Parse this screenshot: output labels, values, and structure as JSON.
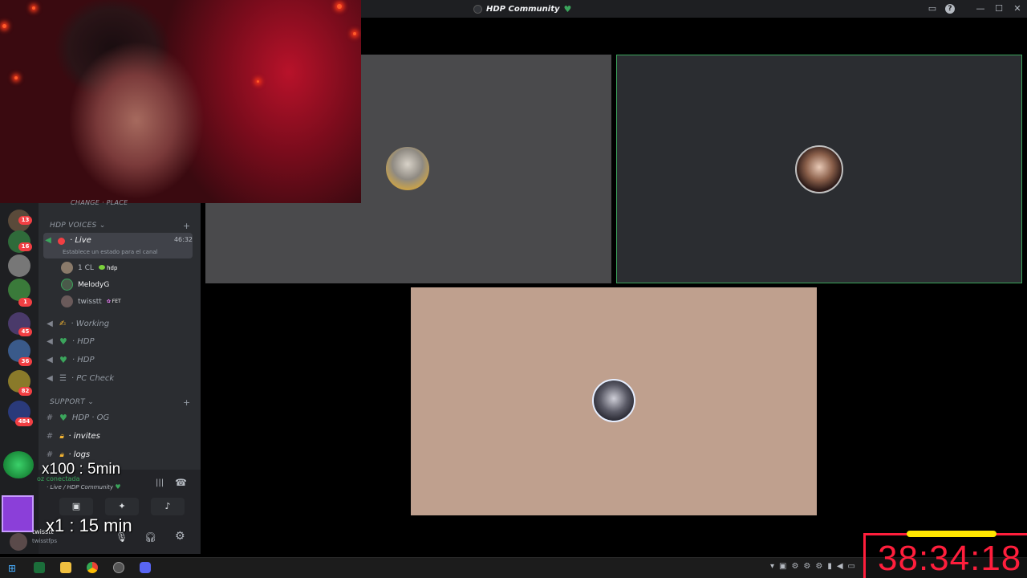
{
  "titlebar": {
    "title": "HDP Community",
    "heart": "♥"
  },
  "sidebar": {
    "top_channel": "CHANGE · PLACE",
    "categories": {
      "voices": "HDP VOICES",
      "support": "SUPPORT"
    },
    "live_channel": {
      "name": "· Live",
      "time": "46:32",
      "status": "Establece un estado para el canal"
    },
    "members": [
      {
        "name": "1 CL",
        "tag": "hdp"
      },
      {
        "name": "MelodyG",
        "tag": ""
      },
      {
        "name": "twisstt",
        "tag": "FET"
      }
    ],
    "voice_channels": [
      "· Working",
      "· HDP",
      "· HDP",
      "· PC Check"
    ],
    "text_channels": [
      "HDP · OG",
      "· invites",
      "· logs"
    ]
  },
  "guild_badges": [
    "13",
    "16",
    "1",
    "45",
    "36",
    "82",
    "484"
  ],
  "voice_panel": {
    "connected": "oz conectada",
    "location": "· Live / HDP Community",
    "user": "twisstt",
    "user_sub": "twisstfps"
  },
  "overlay": {
    "line1": "x100 : 5min",
    "line2": "x1 : 15 min"
  },
  "timer": "38:34:18",
  "colors": {
    "accent_green": "#3ba55c",
    "timer_red": "#ff1e3c",
    "timer_bar": "#ffe600",
    "tile_bg_peach": "#bfa08e"
  }
}
